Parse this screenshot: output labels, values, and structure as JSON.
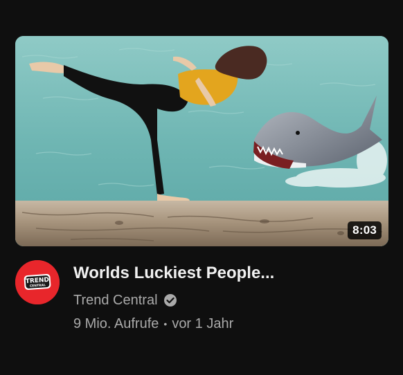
{
  "video": {
    "title": "Worlds Luckiest People...",
    "duration": "8:03",
    "channel": "Trend Central",
    "views": "9 Mio. Aufrufe",
    "separator": "•",
    "age": "vor 1 Jahr",
    "verified": true
  },
  "avatar": {
    "logo_line1": "TREND",
    "logo_line2": "CENTRAL",
    "color": "#e8262b"
  },
  "icons": {
    "verified": "verified-check-icon"
  },
  "colors": {
    "background": "#0f0f0f",
    "title": "#f1f1f1",
    "secondary_text": "#aaaaaa"
  }
}
